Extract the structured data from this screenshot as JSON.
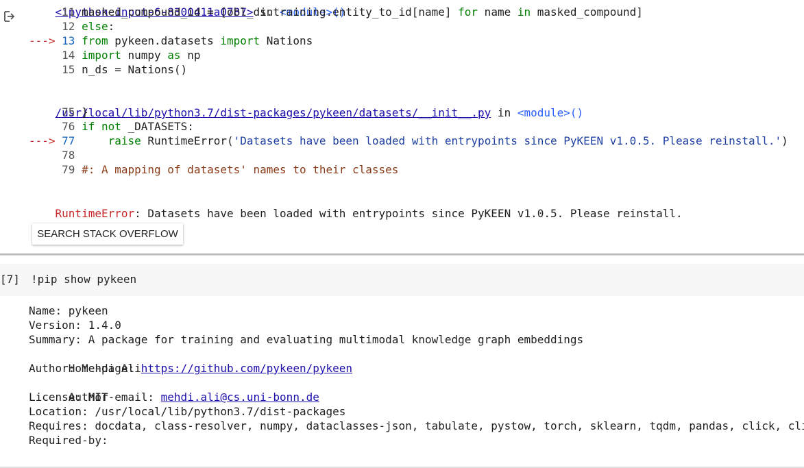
{
  "cell1": {
    "partial_top_line": "<ipython-input-6-8300411a0787> in <module>()",
    "traceback": [
      {
        "num": "11",
        "arrow": "",
        "code": "masked_compound_id = [obl_ds.training.entity_to_id[name] for name in masked_compound]"
      },
      {
        "num": "12",
        "arrow": "",
        "code": "else:"
      },
      {
        "num": "13",
        "arrow": "--->",
        "code": "from pykeen.datasets import Nations"
      },
      {
        "num": "14",
        "arrow": "",
        "code": "import numpy as np"
      },
      {
        "num": "15",
        "arrow": "",
        "code": "n_ds = Nations()"
      }
    ],
    "file_link": "/usr/local/lib/python3.7/dist-packages/pykeen/datasets/__init__.py",
    "file_in": " in ",
    "file_module": "<module>()",
    "traceback2": [
      {
        "num": "75",
        "arrow": "",
        "code": "}"
      },
      {
        "num": "76",
        "arrow": "",
        "code": "if not _DATASETS:"
      },
      {
        "num": "77",
        "arrow": "--->",
        "code": "    raise RuntimeError('Datasets have been loaded with entrypoints since PyKEEN v1.0.5. Please reinstall.')"
      },
      {
        "num": "78",
        "arrow": "",
        "code": ""
      },
      {
        "num": "79",
        "arrow": "",
        "code": "#: A mapping of datasets' names to their classes"
      }
    ],
    "error_name": "RuntimeError",
    "error_message": ": Datasets have been loaded with entrypoints since PyKEEN v1.0.5. Please reinstall.",
    "search_button_label": "SEARCH STACK OVERFLOW"
  },
  "cell2": {
    "exec_count": "[7]",
    "code": "!pip show pykeen",
    "output": {
      "name": "Name: pykeen",
      "version": "Version: 1.4.0",
      "summary": "Summary: A package for training and evaluating multimodal knowledge graph embeddings",
      "homepage_label": "Home-page: ",
      "homepage_link": "https://github.com/pykeen/pykeen",
      "author": "Author: Mehdi Ali",
      "author_email_label": "Author-email: ",
      "author_email_link": "mehdi.ali@cs.uni-bonn.de",
      "license": "License: MIT",
      "location": "Location: /usr/local/lib/python3.7/dist-packages",
      "requires": "Requires: docdata, class-resolver, numpy, dataclasses-json, tabulate, pystow, torch, sklearn, tqdm, pandas, click, click-default-group",
      "required_by": "Required-by:"
    }
  },
  "icons": {
    "output_icon": "output-redirect-icon"
  }
}
